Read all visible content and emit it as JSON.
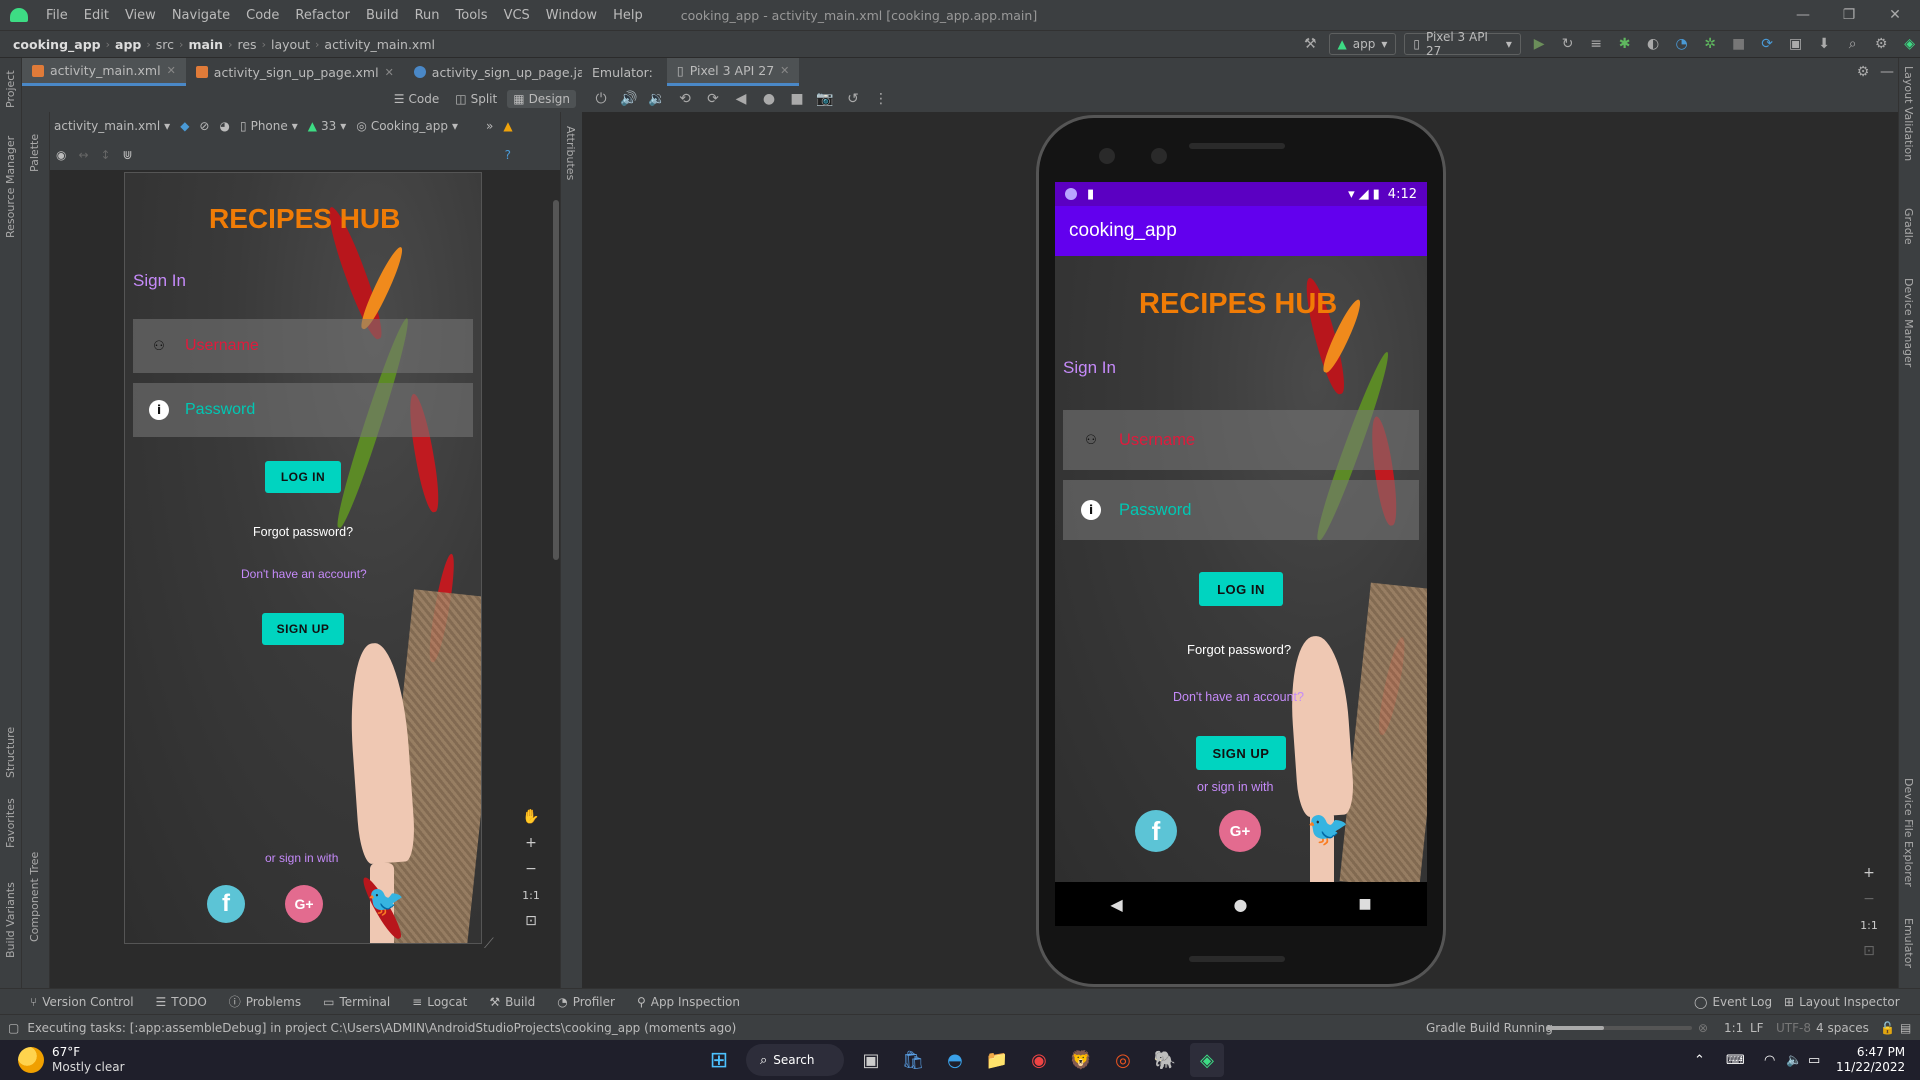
{
  "menubar": {
    "items": [
      "File",
      "Edit",
      "View",
      "Navigate",
      "Code",
      "Refactor",
      "Build",
      "Run",
      "Tools",
      "VCS",
      "Window",
      "Help"
    ],
    "window_title": "cooking_app - activity_main.xml [cooking_app.app.main]"
  },
  "breadcrumb": [
    "cooking_app",
    "app",
    "src",
    "main",
    "res",
    "layout",
    "activity_main.xml"
  ],
  "run_toolbar": {
    "config": "app",
    "device": "Pixel 3 API 27"
  },
  "editor_tabs": [
    {
      "label": "activity_main.xml"
    },
    {
      "label": "activity_sign_up_page.xml"
    },
    {
      "label": "activity_sign_up_page.java"
    }
  ],
  "design_modes": {
    "code": "Code",
    "split": "Split",
    "design": "Design"
  },
  "layout_toolbar": {
    "file": "activity_main.xml",
    "device": "Phone",
    "api": "33",
    "theme": "Cooking_app"
  },
  "side_labels": {
    "left": [
      "Project",
      "Resource Manager",
      "Structure",
      "Favorites",
      "Build Variants"
    ],
    "palette": [
      "Palette",
      "Component Tree"
    ],
    "attributes": "Attributes",
    "right": [
      "Layout Validation",
      "Gradle",
      "Device Manager",
      "Device File Explorer",
      "Emulator"
    ]
  },
  "emulator": {
    "label": "Emulator:",
    "tab": "Pixel 3 API 27",
    "time": "4:12",
    "app_bar_title": "cooking_app"
  },
  "app_screen": {
    "title": "RECIPES HUB",
    "sign_in": "Sign In",
    "username_hint": "Username",
    "password_hint": "Password",
    "login_button": "LOG IN",
    "forgot": "Forgot password?",
    "no_account": "Don't have an account?",
    "signup_button": "SIGN UP",
    "or_sign_in_with": "or sign in with",
    "social": {
      "facebook": "f",
      "google": "G+"
    }
  },
  "zoom": {
    "fit": "1:1"
  },
  "tool_windows": [
    "Version Control",
    "TODO",
    "Problems",
    "Terminal",
    "Logcat",
    "Build",
    "Profiler",
    "App Inspection"
  ],
  "tool_windows_right": [
    "Event Log",
    "Layout Inspector"
  ],
  "status": {
    "message": "Executing tasks: [:app:assembleDebug] in project C:\\Users\\ADMIN\\AndroidStudioProjects\\cooking_app (moments ago)",
    "gradle": "Gradle Build Running",
    "position": "1:1",
    "line_sep": "LF",
    "encoding": "UTF-8",
    "indent": "4 spaces"
  },
  "taskbar": {
    "weather_temp": "67°F",
    "weather_desc": "Mostly clear",
    "search": "Search",
    "time": "6:47 PM",
    "date": "11/22/2022"
  },
  "colors": {
    "accent_title": "#f07c06",
    "purple_text": "#c58af9",
    "button": "#00d4c0",
    "username_text": "#e01a3c",
    "password_text": "#00c8b4",
    "app_bar": "#6200ee"
  }
}
